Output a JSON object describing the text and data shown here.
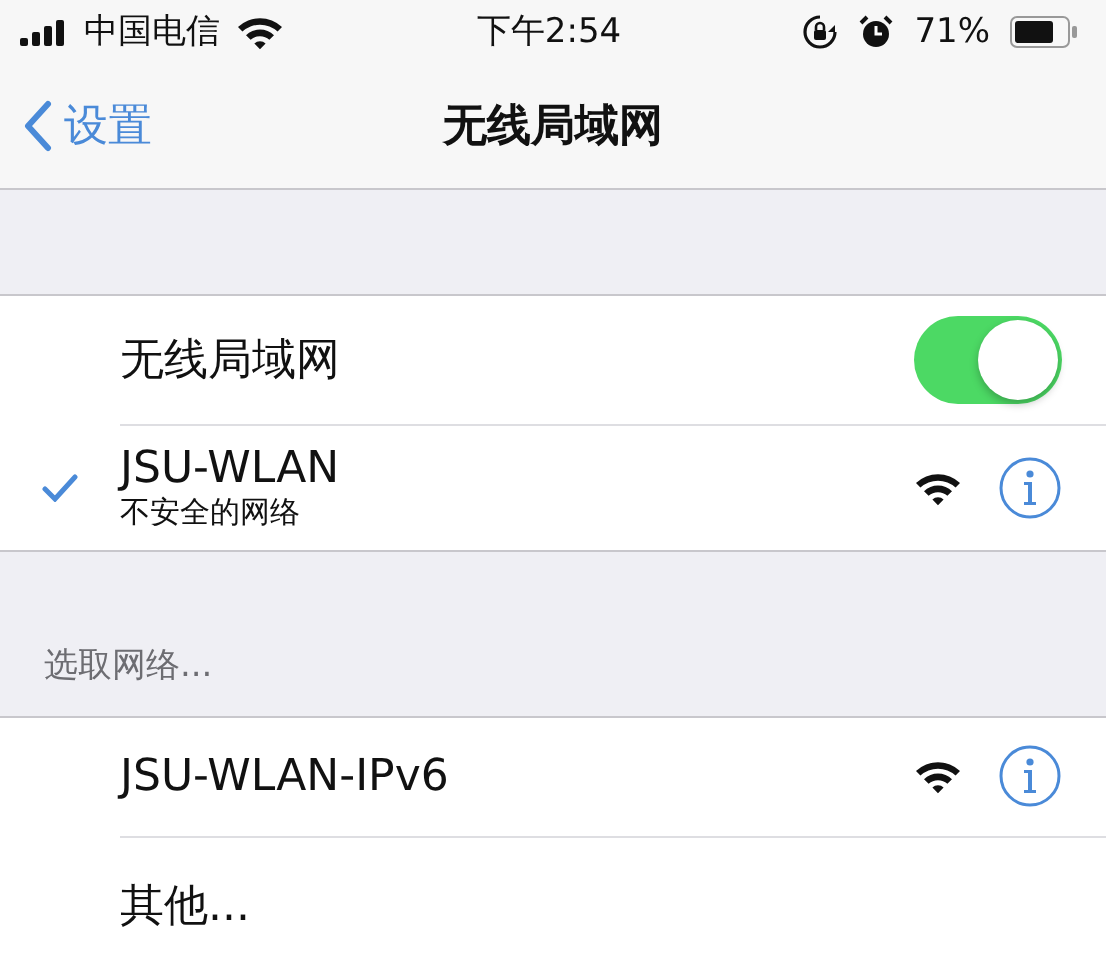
{
  "status_bar": {
    "carrier": "中国电信",
    "time": "下午2:54",
    "battery": "71%"
  },
  "nav": {
    "back": "设置",
    "title": "无线局域网"
  },
  "wifi_toggle": {
    "label": "无线局域网",
    "on": true
  },
  "current_network": {
    "name": "JSU-WLAN",
    "subtitle": "不安全的网络",
    "selected": true
  },
  "section_header": "选取网络...",
  "networks": [
    {
      "kind": "network",
      "name": "JSU-WLAN-IPv6"
    },
    {
      "kind": "other",
      "name": "其他..."
    }
  ]
}
